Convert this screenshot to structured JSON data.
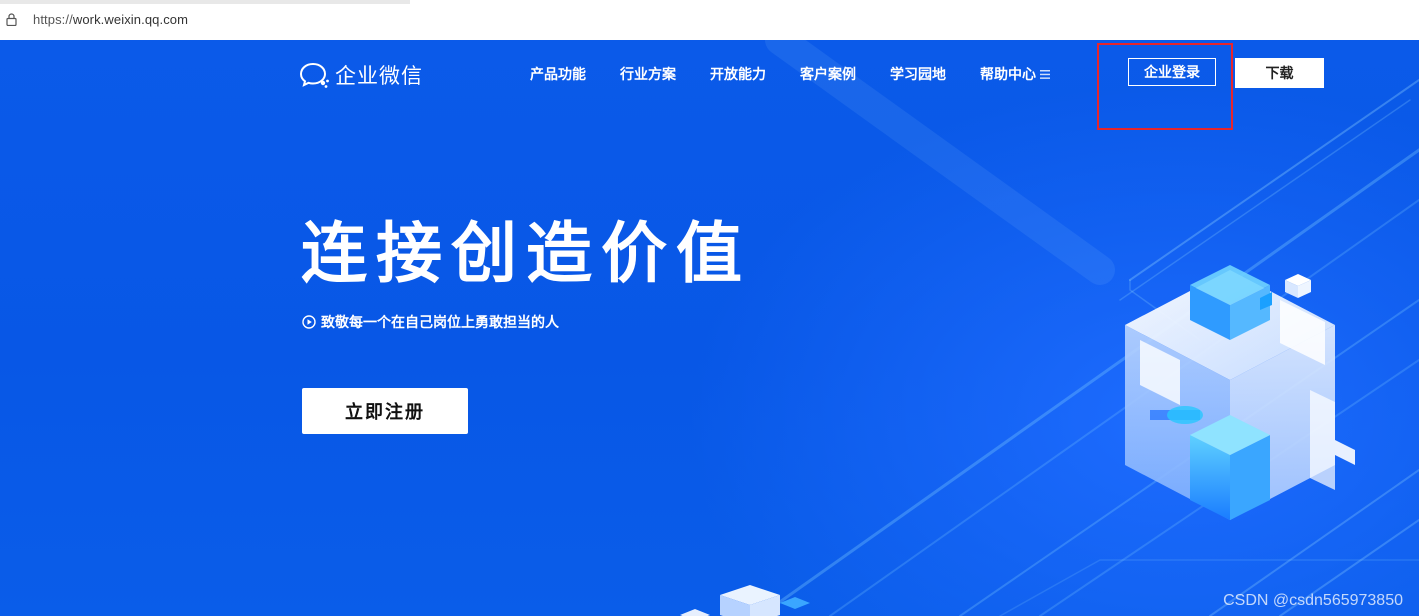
{
  "browser": {
    "url_protocol": "https://",
    "url_host": "work.weixin.qq.com"
  },
  "header": {
    "logo_text": "企业微信",
    "nav": [
      {
        "label": "产品功能"
      },
      {
        "label": "行业方案"
      },
      {
        "label": "开放能力"
      },
      {
        "label": "客户案例"
      },
      {
        "label": "学习园地"
      },
      {
        "label": "帮助中心"
      }
    ],
    "login_label": "企业登录",
    "download_label": "下载"
  },
  "hero": {
    "headline": "连接创造价值",
    "subline": "致敬每一个在自己岗位上勇敢担当的人",
    "register_label": "立即注册"
  },
  "watermark": "CSDN @csdn565973850",
  "colors": {
    "background": "#0a5be8",
    "highlight_border": "#e8252b",
    "button_white": "#ffffff"
  },
  "icons": [
    "lock-icon",
    "chat-bubble-icon",
    "menu-icon",
    "play-circle-icon"
  ]
}
